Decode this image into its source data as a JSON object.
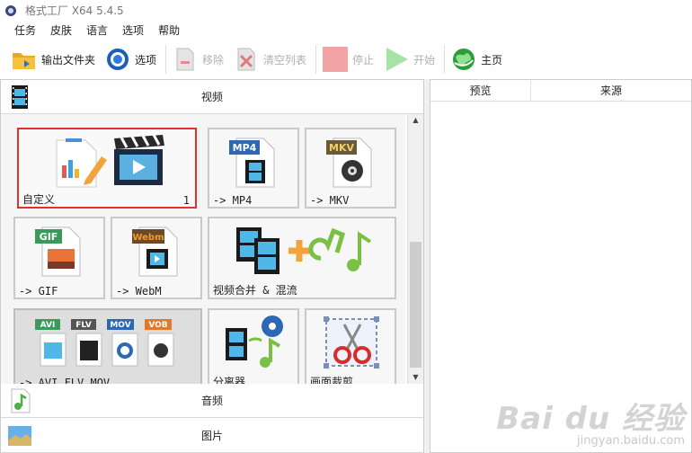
{
  "window": {
    "title": "格式工厂 X64 5.4.5"
  },
  "menu": [
    "任务",
    "皮肤",
    "语言",
    "选项",
    "帮助"
  ],
  "toolbar": {
    "output_folder": "输出文件夹",
    "options": "选项",
    "remove": "移除",
    "clear_list": "清空列表",
    "stop": "停止",
    "start": "开始",
    "home": "主页"
  },
  "sections": {
    "video": "视频",
    "audio": "音频",
    "image": "图片"
  },
  "tiles": {
    "custom": {
      "label": "自定义",
      "count": "1"
    },
    "mp4": {
      "label": "-> MP4",
      "badge": "MP4"
    },
    "mkv": {
      "label": "-> MKV",
      "badge": "MKV"
    },
    "gif": {
      "label": "-> GIF",
      "badge": "GIF"
    },
    "webm": {
      "label": "-> WebM",
      "badge": "Webm"
    },
    "merge": {
      "label": "视频合并 & 混流"
    },
    "avi_flv_mov": {
      "label": "-> AVI FLV MOV ....",
      "badges": [
        "AVI",
        "FLV",
        "MOV",
        "VOB"
      ]
    },
    "splitter": {
      "label": "分离器"
    },
    "crop": {
      "label": "画面裁剪"
    }
  },
  "file_list": {
    "columns": [
      "预览",
      "来源"
    ]
  },
  "watermark": {
    "logo": "Bai du 经验",
    "url": "jingyan.baidu.com"
  }
}
